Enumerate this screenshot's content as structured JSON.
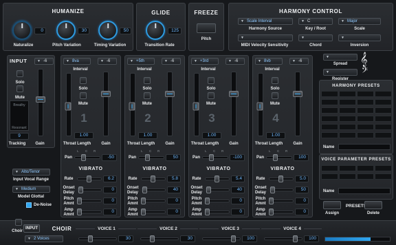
{
  "humanize": {
    "title": "HUMANIZE",
    "knobs": [
      {
        "label": "Naturalize",
        "value": "0"
      },
      {
        "label": "Pitch Variation",
        "value": "30"
      },
      {
        "label": "Timing Variation",
        "value": "50"
      }
    ]
  },
  "glide": {
    "title": "GLIDE",
    "label": "Transition Rate",
    "value": "125"
  },
  "freeze": {
    "title": "FREEZE",
    "label": "Pitch"
  },
  "harmony": {
    "title": "HARMONY CONTROL",
    "source_value": "Scale Interval",
    "source_label": "Harmony Source",
    "key_value": "C",
    "key_label": "Key / Root",
    "scale_value": "Major",
    "scale_label": "Scale",
    "midi_label": "MIDI Velocity Sensitivity",
    "chord_label": "Chord",
    "inversion_label": "Inversion"
  },
  "register": {
    "spread_label": "Spread",
    "register_label": "Register"
  },
  "input": {
    "title": "INPUT",
    "top_value": "-6",
    "solo": "Solo",
    "mute": "Mute",
    "meter_labels": [
      "Breathy",
      "Resonant"
    ],
    "tracking_label": "Tracking",
    "tracking_value": "9",
    "gain_label": "Gain",
    "vocal_range_value": "Alto/Tenor",
    "vocal_range_label": "Input Vocal Range",
    "model_value": "Medium",
    "model_label": "Model Glottal",
    "denoise_label": "De-Noise"
  },
  "voices": [
    {
      "number": "1",
      "interval": "8va",
      "gain_top": "-6",
      "throat": "1.00",
      "pan": "-50",
      "rate": "6.2",
      "onset": "0",
      "pitch_amnt": "0",
      "amp_amnt": "0"
    },
    {
      "number": "2",
      "interval": "+5th",
      "gain_top": "-6",
      "throat": "1.00",
      "pan": "50",
      "rate": "5.8",
      "onset": "40",
      "pitch_amnt": "0",
      "amp_amnt": "0"
    },
    {
      "number": "3",
      "interval": "+3rd",
      "gain_top": "-6",
      "throat": "1.00",
      "pan": "-100",
      "rate": "5.4",
      "onset": "40",
      "pitch_amnt": "0",
      "amp_amnt": "0"
    },
    {
      "number": "4",
      "interval": "8vb",
      "gain_top": "-6",
      "throat": "1.00",
      "pan": "100",
      "rate": "5.0",
      "onset": "50",
      "pitch_amnt": "0",
      "amp_amnt": "0"
    }
  ],
  "voice_labels": {
    "interval": "Interval",
    "solo": "Solo",
    "mute": "Mute",
    "throat": "Throat Length",
    "gain": "Gain",
    "pan": "Pan",
    "pan_l": "L",
    "pan_c": "C",
    "pan_r": "R",
    "vibrato": "VIBRATO",
    "rate": "Rate",
    "onset": "Onset Delay",
    "pitch_amnt": "Pitch Amnt",
    "amp_amnt": "Amp Amnt"
  },
  "presets": {
    "harmony_title": "HARMONY PRESETS",
    "name_label": "Name",
    "voice_title": "VOICE PARAMETER PRESETS",
    "name_label2": "Name",
    "presets_label": "PRESETS",
    "assign_label": "Assign",
    "delete_label": "Delete"
  },
  "footer": {
    "choir_label": "Choir",
    "input_label": "INPUT",
    "choir_title": "CHOIR",
    "voices_value": "2 Voices",
    "voice_tabs": [
      "VOICE 1",
      "VOICE 2",
      "VOICE 3",
      "VOICE 4"
    ],
    "values": [
      "30",
      "30",
      "100",
      "100"
    ]
  },
  "colors": {
    "accent": "#2e9be0",
    "value_text": "#6fb8ff",
    "background": "#16181b"
  }
}
